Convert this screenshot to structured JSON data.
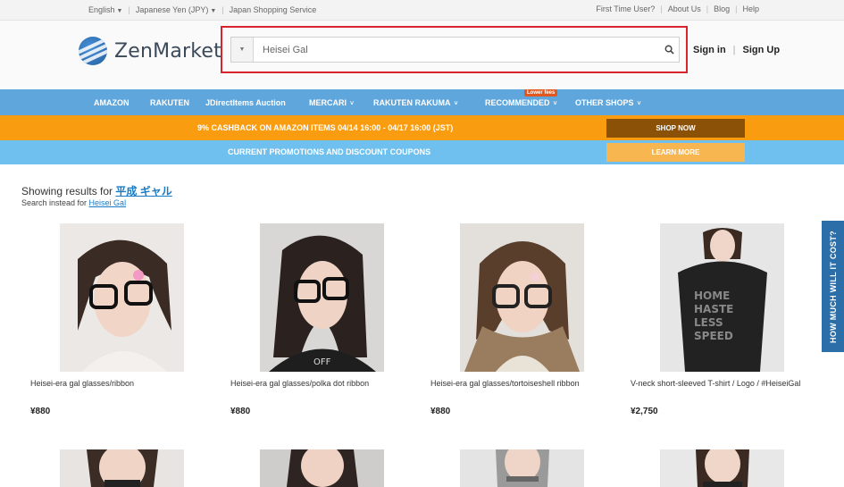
{
  "topbar": {
    "language": "English",
    "currency": "Japanese Yen (JPY)",
    "service": "Japan Shopping Service",
    "links": [
      "First Time User?",
      "About Us",
      "Blog",
      "Help"
    ]
  },
  "header": {
    "logo_text": "ZenMarket",
    "search_value": "Heisei Gal",
    "sign_in": "Sign in",
    "sign_up": "Sign Up"
  },
  "nav": {
    "items": [
      "AMAZON",
      "RAKUTEN",
      "JDirectItems Auction",
      "MERCARI",
      "RAKUTEN RAKUMA",
      "RECOMMENDED",
      "OTHER SHOPS"
    ],
    "badge": "Lower fees"
  },
  "promos": {
    "cashback_text": "9% CASHBACK ON AMAZON ITEMS 04/14 16:00 - 04/17 16:00 (JST)",
    "cashback_button": "SHOP NOW",
    "coupons_text": "CURRENT PROMOTIONS AND DISCOUNT COUPONS",
    "coupons_button": "LEARN MORE"
  },
  "results": {
    "prefix": "Showing results for ",
    "query_jp": "平成 ギャル",
    "alt_prefix": "Search instead for ",
    "alt_query": "Heisei Gal",
    "products": [
      {
        "name": "Heisei-era gal glasses/ribbon",
        "price": "¥880"
      },
      {
        "name": "Heisei-era gal glasses/polka dot ribbon",
        "price": "¥880"
      },
      {
        "name": "Heisei-era gal glasses/tortoiseshell ribbon",
        "price": "¥880"
      },
      {
        "name": "V-neck short-sleeved T-shirt / Logo / #HeiseiGal",
        "price": "¥2,750"
      }
    ]
  },
  "sidetab_label": "HOW MUCH WILL IT COST?",
  "colors": {
    "nav_blue": "#5fa6dc",
    "promo_orange": "#f99c0f",
    "promo_blue": "#6fc0ee",
    "highlight_red": "#d9232d",
    "link_blue": "#1a7bc4"
  }
}
